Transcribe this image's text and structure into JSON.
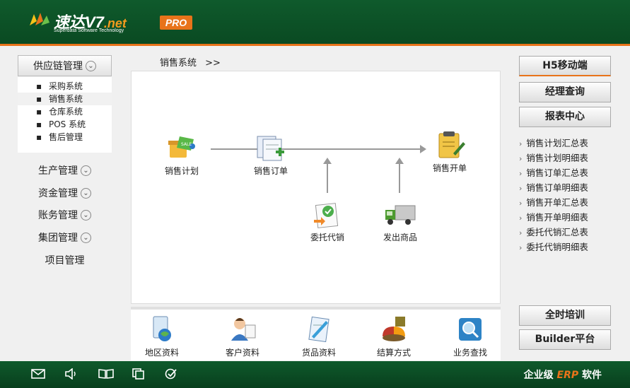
{
  "header": {
    "logo_title_main": "速达V7",
    "logo_title_suffix": ".net",
    "logo_subtitle": "Superdata Software Technology",
    "badge": "PRO"
  },
  "left_nav": {
    "expanded_group": "供应链管理",
    "sub_items": [
      {
        "label": "采购系统",
        "active": false
      },
      {
        "label": "销售系统",
        "active": true
      },
      {
        "label": "仓库系统",
        "active": false
      },
      {
        "label": "POS 系统",
        "active": false
      },
      {
        "label": "售后管理",
        "active": false
      }
    ],
    "groups": [
      {
        "label": "生产管理",
        "chevron": true
      },
      {
        "label": "资金管理",
        "chevron": true
      },
      {
        "label": "账务管理",
        "chevron": true
      },
      {
        "label": "集团管理",
        "chevron": true
      },
      {
        "label": "项目管理",
        "chevron": false
      }
    ],
    "chevron_glyph": "⌄"
  },
  "breadcrumb": {
    "label": "销售系统",
    "arrow": ">>"
  },
  "flow": {
    "nodes": [
      {
        "label": "销售计划",
        "icon": "sales-plan-icon"
      },
      {
        "label": "销售订单",
        "icon": "sales-order-icon"
      },
      {
        "label": "销售开单",
        "icon": "sales-invoice-icon"
      },
      {
        "label": "委托代销",
        "icon": "consignment-icon"
      },
      {
        "label": "发出商品",
        "icon": "delivery-truck-icon"
      }
    ]
  },
  "bottom_shortcuts": [
    {
      "label": "地区资料",
      "icon": "region-icon"
    },
    {
      "label": "客户资料",
      "icon": "customer-icon"
    },
    {
      "label": "货品资料",
      "icon": "goods-icon"
    },
    {
      "label": "结算方式",
      "icon": "settlement-icon"
    },
    {
      "label": "业务查找",
      "icon": "search-icon"
    }
  ],
  "right_panel": {
    "buttons_top": [
      "H5移动端",
      "经理查询",
      "报表中心"
    ],
    "report_links": [
      "销售计划汇总表",
      "销售计划明细表",
      "销售订单汇总表",
      "销售订单明细表",
      "销售开单汇总表",
      "销售开单明细表",
      "委托代销汇总表",
      "委托代销明细表"
    ],
    "link_arrow": "›",
    "buttons_bottom": [
      "全时培训",
      "Builder平台"
    ]
  },
  "footer": {
    "icons": [
      "mail-icon",
      "volume-icon",
      "book-icon",
      "copy-icon",
      "check-icon"
    ],
    "brand_prefix": "企业级",
    "brand_erp": "ERP",
    "brand_suffix": "软件"
  },
  "colors": {
    "header_green": "#0f5a2c",
    "accent_orange": "#e8731a"
  }
}
